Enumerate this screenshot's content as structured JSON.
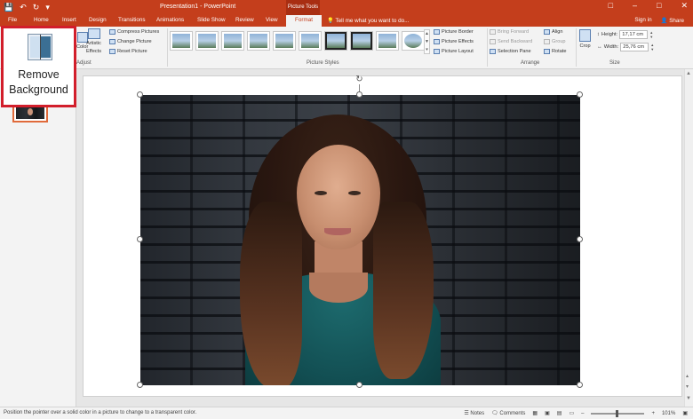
{
  "app": {
    "window_title": "Presentation1 - PowerPoint",
    "contextual_tab_group": "Picture Tools"
  },
  "quick_access": {
    "save_icon": "save-icon",
    "undo_icon": "undo-icon",
    "redo_icon": "redo-icon",
    "customize_icon": "chevron-down-icon"
  },
  "tabs": [
    {
      "label": "File"
    },
    {
      "label": "Home"
    },
    {
      "label": "Insert"
    },
    {
      "label": "Design"
    },
    {
      "label": "Transitions"
    },
    {
      "label": "Animations"
    },
    {
      "label": "Slide Show"
    },
    {
      "label": "Review"
    },
    {
      "label": "View"
    },
    {
      "label": "Format",
      "active": true
    }
  ],
  "tell_me": "Tell me what you want to do...",
  "account": {
    "sign_in": "Sign in",
    "share": "Share"
  },
  "ribbon": {
    "remove_background": {
      "line1": "Remove",
      "line2": "Background"
    },
    "adjust": {
      "color_label": "Color",
      "artistic_effects_line1": "Artistic",
      "artistic_effects_line2": "Effects",
      "compress": "Compress Pictures",
      "change": "Change Picture",
      "reset": "Reset Picture",
      "group_label": "Adjust"
    },
    "picture_styles": {
      "group_label": "Picture Styles",
      "border": "Picture Border",
      "effects": "Picture Effects",
      "layout": "Picture Layout"
    },
    "arrange": {
      "group_label": "Arrange",
      "bring_forward": "Bring Forward",
      "send_backward": "Send Backward",
      "selection_pane": "Selection Pane",
      "align": "Align",
      "group": "Group",
      "rotate": "Rotate"
    },
    "size": {
      "group_label": "Size",
      "crop": "Crop",
      "height_label": "Height:",
      "height_value": "17,17 cm",
      "width_label": "Width:",
      "width_value": "25,76 cm"
    }
  },
  "slides": [
    {
      "number": "1"
    }
  ],
  "status": {
    "message": "Position the pointer over a solid color in a picture to change to a transparent color.",
    "notes": "Notes",
    "comments": "Comments",
    "zoom": "101%"
  }
}
